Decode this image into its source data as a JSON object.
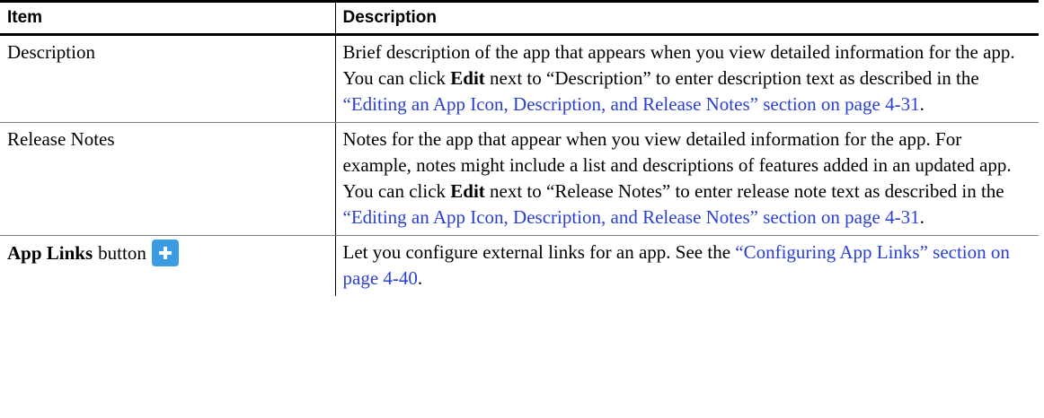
{
  "header": {
    "item": "Item",
    "description": "Description"
  },
  "rows": [
    {
      "item": "Description",
      "text_1": "Brief description of the app that appears when you view detailed information for the app. You can click ",
      "edit": "Edit",
      "text_2": " next to “Description” to enter description text as described in the ",
      "link": "“Editing an App Icon, Description, and Release Notes” section on page 4-31",
      "text_3": "."
    },
    {
      "item": "Release Notes",
      "text_1": "Notes for the app that appear when you view detailed information for the app. For example, notes might include a list and descriptions of features added in an updated app. You can click ",
      "edit": "Edit",
      "text_2": " next to “Release Notes” to enter release note text as described in the ",
      "link": "“Editing an App Icon, Description, and Release Notes” section on page 4-31",
      "text_3": "."
    },
    {
      "item_bold": "App Links",
      "item_rest": "button",
      "icon": "plus-icon",
      "text_1": "Let you configure external links for an app. See the ",
      "link": "“Configuring App Links” section on page 4-40",
      "text_2": "."
    }
  ],
  "colors": {
    "link": "#2a3fd2",
    "button_blue": "#3b9be3"
  }
}
